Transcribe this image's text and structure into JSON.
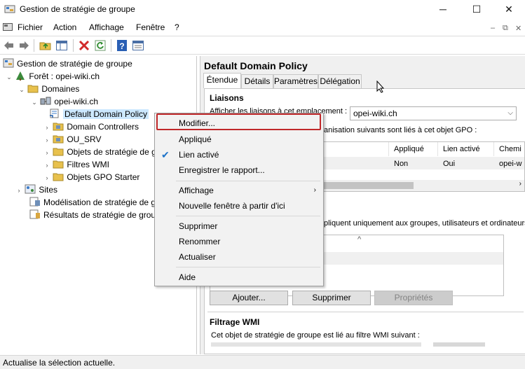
{
  "window": {
    "title": "Gestion de stratégie de groupe",
    "minimize_icon": "─",
    "maximize_icon": "☐",
    "close_icon": "✕"
  },
  "menubar": {
    "items": [
      "Fichier",
      "Action",
      "Affichage",
      "Fenêtre",
      "?"
    ],
    "mdi_minimize": "–",
    "mdi_restore": "⧉",
    "mdi_close": "✕"
  },
  "toolbar": {
    "icons": [
      "back-arrow-icon",
      "forward-arrow-icon",
      "folder-up-icon",
      "show-tree-icon",
      "delete-icon",
      "refresh-icon",
      "help-icon",
      "properties-icon"
    ]
  },
  "tree": {
    "root": "Gestion de stratégie de groupe",
    "forest": "Forêt : opei-wiki.ch",
    "domains": "Domaines",
    "domain": "opei-wiki.ch",
    "items": [
      "Default Domain Policy",
      "Domain Controllers",
      "OU_SRV",
      "Objets de stratégie de g",
      "Filtres WMI",
      "Objets GPO Starter"
    ],
    "sites": "Sites",
    "modeling": "Modélisation de stratégie de g",
    "results": "Résultats de stratégie de group"
  },
  "details": {
    "title": "Default Domain Policy",
    "tabs": [
      "Étendue",
      "Détails",
      "Paramètres",
      "Délégation"
    ],
    "active_tab": "Étendue",
    "links_heading": "Liaisons",
    "links_label": "Afficher les liaisons à cet emplacement :",
    "links_location": "opei-wiki.ch",
    "links_desc": "anisation suivants sont liés à cet objet GPO :",
    "links_columns": [
      "Appliqué",
      "Lien activé",
      "Chemi"
    ],
    "links_row": [
      "Non",
      "Oui",
      "opei-w"
    ],
    "filter_desc": "pliquent uniquement aux groupes, utilisateurs et ordinateurs",
    "sort_icon": "^",
    "buttons": {
      "add": "Ajouter...",
      "remove": "Supprimer",
      "properties": "Propriétés"
    },
    "wmi_heading": "Filtrage WMI",
    "wmi_desc": "Cet objet de stratégie de groupe est lié au filtre WMI suivant :"
  },
  "context_menu": {
    "items": [
      "Modifier...",
      "Appliqué",
      "Lien activé",
      "Enregistrer le rapport...",
      "Affichage",
      "Nouvelle fenêtre à partir d'ici",
      "Supprimer",
      "Renommer",
      "Actualiser",
      "Aide"
    ],
    "checked_item": "Lien activé",
    "check_glyph": "✔",
    "submenu_glyph": "›"
  },
  "status": {
    "text": "Actualise la sélection actuelle."
  },
  "colors": {
    "selection": "#cce8ff",
    "highlight_box": "#c0282a",
    "check": "#1e73c8"
  }
}
